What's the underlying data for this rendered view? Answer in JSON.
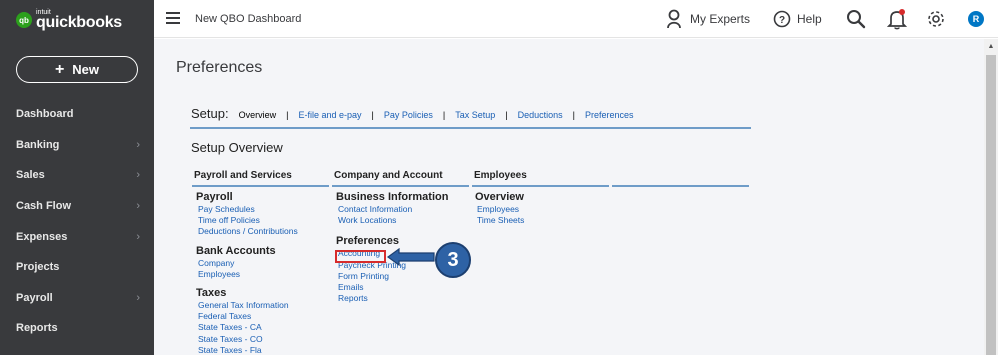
{
  "brand": {
    "mark": "qb",
    "intuit": "intuit",
    "name": "quickbooks"
  },
  "sidebar": {
    "new_label": "New",
    "items": [
      {
        "label": "Dashboard",
        "chevron": false
      },
      {
        "label": "Banking",
        "chevron": true
      },
      {
        "label": "Sales",
        "chevron": true
      },
      {
        "label": "Cash Flow",
        "chevron": true
      },
      {
        "label": "Expenses",
        "chevron": true
      },
      {
        "label": "Projects",
        "chevron": false
      },
      {
        "label": "Payroll",
        "chevron": true
      },
      {
        "label": "Reports",
        "chevron": false
      }
    ]
  },
  "topbar": {
    "page_name": "New QBO Dashboard",
    "experts_label": "My Experts",
    "help_label": "Help",
    "avatar_initial": "R"
  },
  "page": {
    "title": "Preferences",
    "setup_label": "Setup:",
    "setup_tabs": [
      "Overview",
      "E-file and e-pay",
      "Pay Policies",
      "Tax Setup",
      "Deductions",
      "Preferences"
    ],
    "overview_title": "Setup Overview",
    "columns": [
      "Payroll and Services",
      "Company and Account",
      "Employees",
      ""
    ],
    "payroll_col": {
      "payroll": {
        "title": "Payroll",
        "links": [
          "Pay Schedules",
          "Time off Policies",
          "Deductions / Contributions"
        ]
      },
      "bank": {
        "title": "Bank Accounts",
        "links": [
          "Company",
          "Employees"
        ]
      },
      "taxes": {
        "title": "Taxes",
        "links": [
          "General Tax Information",
          "Federal Taxes",
          "State Taxes - CA",
          "State Taxes - CO",
          "State Taxes - Fla"
        ]
      }
    },
    "company_col": {
      "business": {
        "title": "Business Information",
        "links": [
          "Contact Information",
          "Work Locations"
        ]
      },
      "preferences": {
        "title": "Preferences",
        "links": [
          "Accounting",
          "Paycheck Printing",
          "Form Printing",
          "Emails",
          "Reports"
        ]
      }
    },
    "employees_col": {
      "overview": {
        "title": "Overview",
        "links": [
          "Employees",
          "Time Sheets"
        ]
      }
    }
  },
  "annotation": {
    "step": "3"
  },
  "colors": {
    "sidebar": "#393a3d",
    "link": "#1a5fb4",
    "accent_line": "#6e9cc8",
    "annotation_red": "#d62b2b",
    "step_circle": "#2e62a5",
    "brand_green": "#2ca01c"
  }
}
